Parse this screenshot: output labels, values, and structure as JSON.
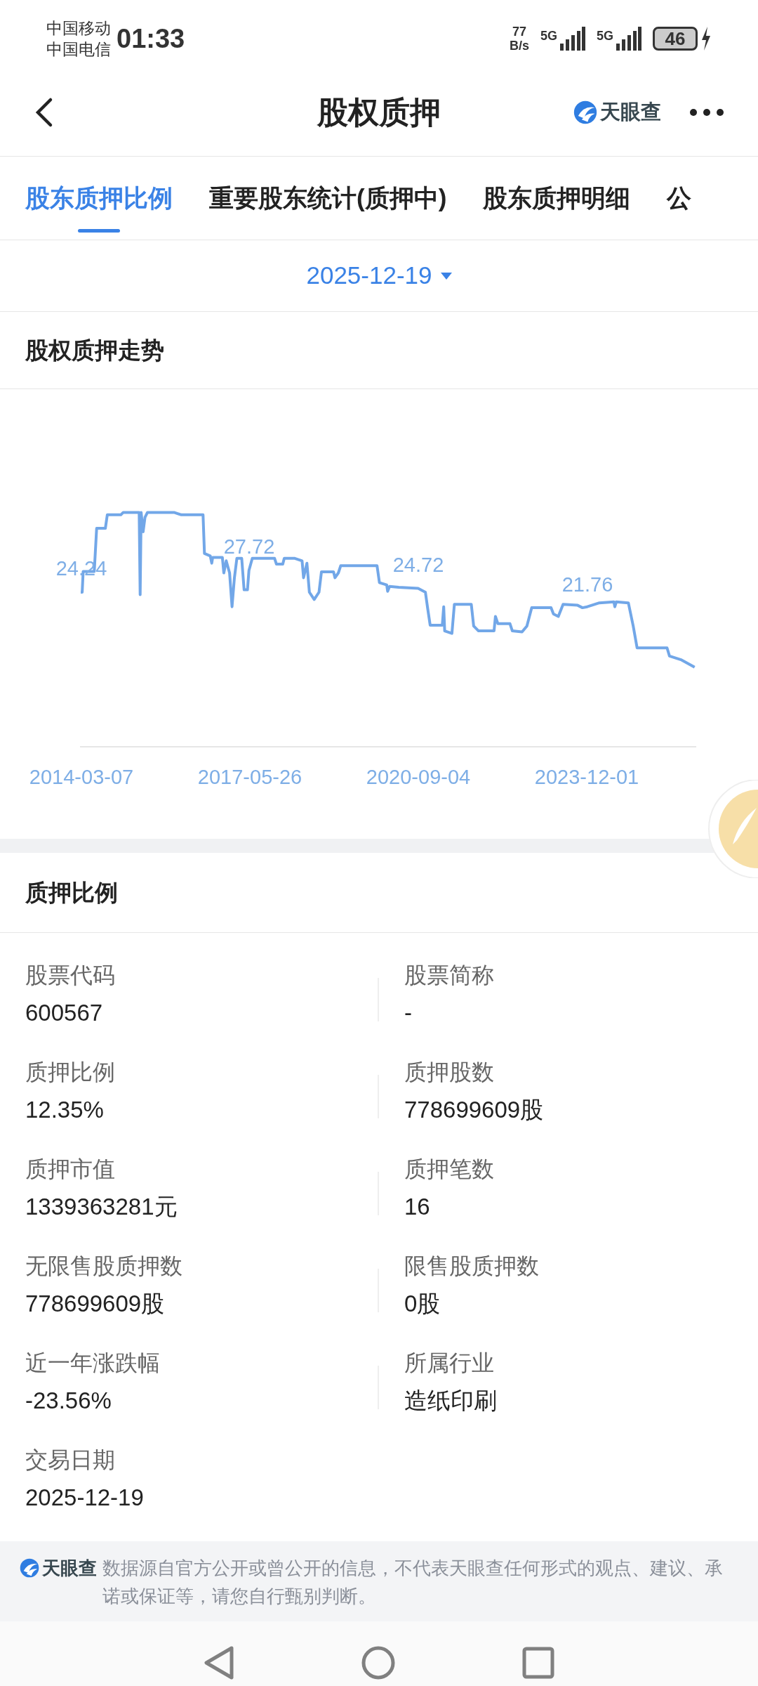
{
  "status_bar": {
    "carriers": [
      "中国移动",
      "中国电信"
    ],
    "time": "01:33",
    "net_speed": [
      "77",
      "B/s"
    ],
    "signals": [
      "5G",
      "5G"
    ],
    "battery": "46"
  },
  "header": {
    "title": "股权质押",
    "brand": "天眼查"
  },
  "tabs": [
    {
      "label": "股东质押比例",
      "selected": true
    },
    {
      "label": "重要股东统计(质押中)",
      "selected": false
    },
    {
      "label": "股东质押明细",
      "selected": false
    },
    {
      "label": "公",
      "selected": false
    }
  ],
  "date_picker": {
    "value": "2025-12-19"
  },
  "trend": {
    "title": "股权质押走势",
    "point_labels": [
      "24.24",
      "27.72",
      "24.72",
      "21.76"
    ],
    "x_labels": [
      "2014-03-07",
      "2017-05-26",
      "2020-09-04",
      "2023-12-01"
    ]
  },
  "ratio": {
    "title": "质押比例",
    "fields": [
      {
        "label": "股票代码",
        "value": "600567"
      },
      {
        "label": "股票简称",
        "value": "-"
      },
      {
        "label": "质押比例",
        "value": "12.35%"
      },
      {
        "label": "质押股数",
        "value": "778699609股"
      },
      {
        "label": "质押市值",
        "value": "1339363281元"
      },
      {
        "label": "质押笔数",
        "value": "16"
      },
      {
        "label": "无限售股质押数",
        "value": "778699609股"
      },
      {
        "label": "限售股质押数",
        "value": "0股"
      },
      {
        "label": "近一年涨跌幅",
        "value": "-23.56%"
      },
      {
        "label": "所属行业",
        "value": "造纸印刷"
      },
      {
        "label": "交易日期",
        "value": "2025-12-19"
      }
    ]
  },
  "disclaimer": {
    "brand": "天眼查",
    "text": "数据源自官方公开或曾公开的信息，不代表天眼查任何形式的观点、建议、承诺或保证等，请您自行甄别判断。"
  }
}
